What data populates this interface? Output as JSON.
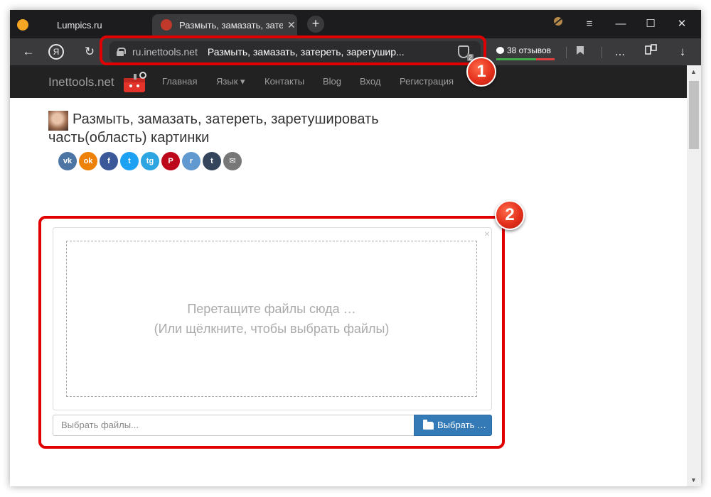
{
  "browser": {
    "tabs": [
      {
        "label": "Lumpics.ru"
      },
      {
        "label": "Размыть, замазать, затереть",
        "active": true
      }
    ],
    "address": {
      "domain": "ru.inettools.net",
      "title": "Размыть, замазать, затереть, заретушир...",
      "shield_count": "2"
    },
    "reviews_label": "38 отзывов",
    "window_buttons": {
      "menu": "≡",
      "minimize": "—",
      "maximize": "☐",
      "close": "✕"
    },
    "nav_glyphs": {
      "back": "←",
      "yandex": "Я",
      "reload": "↻",
      "new_tab": "+",
      "tab_close": "✕",
      "more": "...",
      "download": "↓"
    }
  },
  "site": {
    "brand": "Inettools.net",
    "nav": [
      {
        "label": "Главная"
      },
      {
        "label": "Язык ▾"
      },
      {
        "label": "Контакты"
      },
      {
        "label": "Blog"
      },
      {
        "label": "Вход"
      },
      {
        "label": "Регистрация"
      }
    ]
  },
  "page": {
    "title": "Размыть, замазать, затереть, заретушировать часть(область) картинки",
    "share": [
      {
        "label": "vk",
        "color": "#4c75a3"
      },
      {
        "label": "ok",
        "color": "#ee8208"
      },
      {
        "label": "f",
        "color": "#3b5998"
      },
      {
        "label": "t",
        "color": "#1da1f2"
      },
      {
        "label": "tg",
        "color": "#2ca5e0"
      },
      {
        "label": "P",
        "color": "#bd081c"
      },
      {
        "label": "r",
        "color": "#5f99cf"
      },
      {
        "label": "t",
        "color": "#35465c"
      },
      {
        "label": "✉",
        "color": "#777777"
      }
    ]
  },
  "upload": {
    "close": "×",
    "drop_line1": "Перетащите файлы сюда …",
    "drop_line2": "(Или щёлкните, чтобы выбрать файлы)",
    "placeholder": "Выбрать файлы...",
    "button": "Выбрать …"
  },
  "markers": [
    "1",
    "2"
  ]
}
